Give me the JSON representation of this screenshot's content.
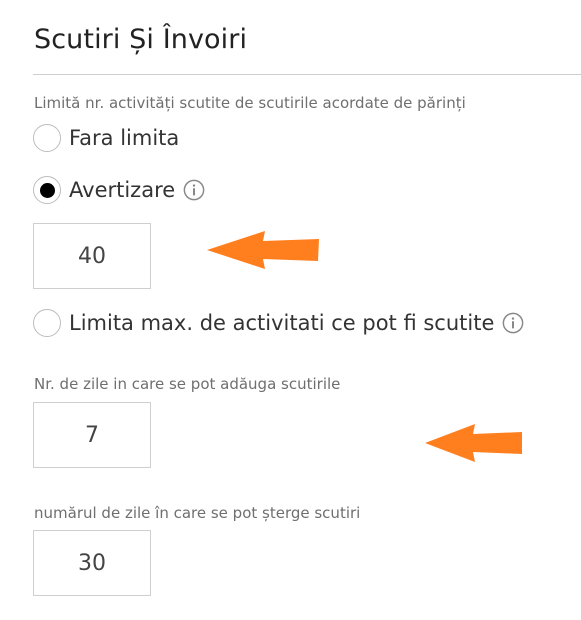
{
  "section": {
    "title": "Scutiri Și Învoiri"
  },
  "limit": {
    "label": "Limită nr. activități scutite de scutirile acordate de părinți",
    "options": [
      {
        "label": "Fara limita",
        "selected": false
      },
      {
        "label": "Avertizare",
        "selected": true,
        "info_icon": "info-circle-icon"
      },
      {
        "label": "Limita max. de activitati ce pot fi scutite",
        "selected": false,
        "info_icon": "info-circle-icon"
      }
    ],
    "warning_value": "40"
  },
  "add_days": {
    "label": "Nr. de zile in care se pot adăuga scutirile",
    "value": "7"
  },
  "delete_days": {
    "label": "numărul de zile în care se pot șterge scutiri",
    "value": "30"
  },
  "annotations": {
    "arrow_color": "#ff7f1e",
    "arrow_icon": "left-arrow-icon"
  }
}
